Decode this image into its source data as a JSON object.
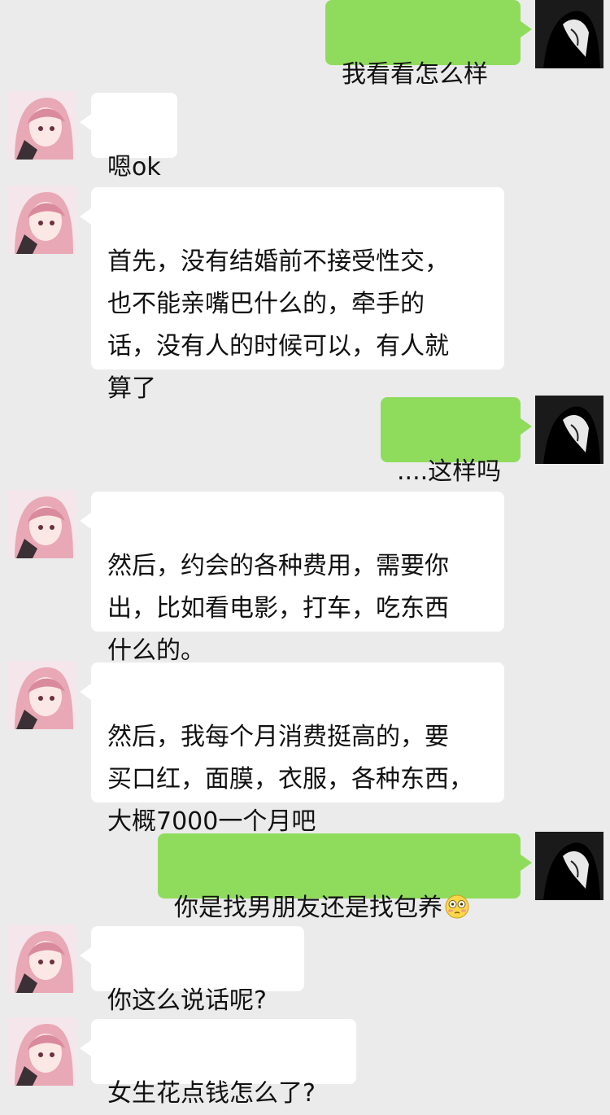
{
  "messages": [
    {
      "side": "out",
      "text": "我看看怎么样"
    },
    {
      "side": "in",
      "text": "嗯ok"
    },
    {
      "side": "in",
      "text": "首先，没有结婚前不接受性交，\n也不能亲嘴巴什么的，牵手的\n话，没有人的时候可以，有人就\n算了"
    },
    {
      "side": "out",
      "text": "....这样吗"
    },
    {
      "side": "in",
      "text": "然后，约会的各种费用，需要你\n出，比如看电影，打车，吃东西\n什么的。"
    },
    {
      "side": "in",
      "text": "然后，我每个月消费挺高的，要\n买口红，面膜，衣服，各种东西，\n大概7000一个月吧"
    },
    {
      "side": "out",
      "text": "你是找男朋友还是找包养",
      "emoji": "flushed-emoji-icon"
    },
    {
      "side": "in",
      "text": "你这么说话呢?"
    },
    {
      "side": "in",
      "text": "女生花点钱怎么了?"
    }
  ],
  "colors": {
    "background": "#ebebeb",
    "incoming_bubble": "#ffffff",
    "outgoing_bubble": "#8fdc5c"
  }
}
